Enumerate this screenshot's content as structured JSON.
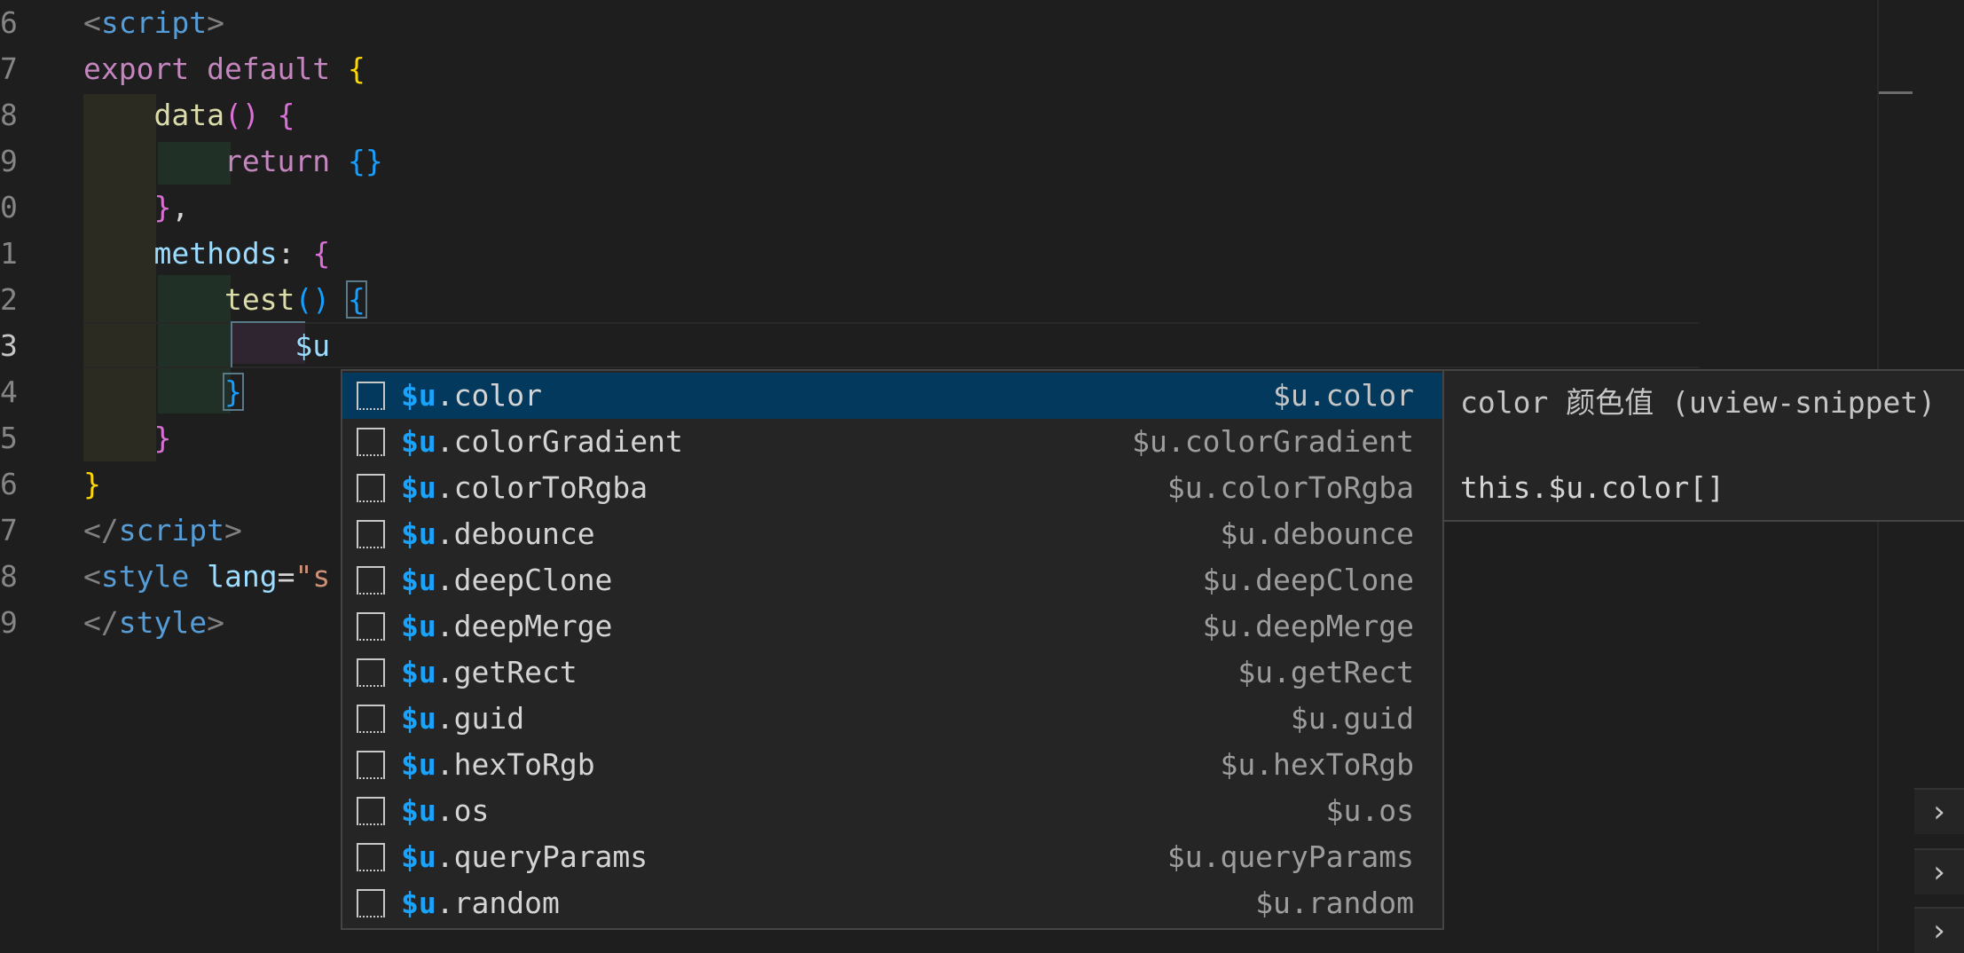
{
  "editor": {
    "line_numbers": [
      "6",
      "7",
      "8",
      "9",
      "0",
      "1",
      "2",
      "3",
      "4",
      "5",
      "6",
      "7",
      "8",
      "9"
    ],
    "active_line_number": "3",
    "lines": [
      [
        {
          "t": "<",
          "c": "c-tag"
        },
        {
          "t": "script",
          "c": "c-tagname"
        },
        {
          "t": ">",
          "c": "c-tag"
        }
      ],
      [
        {
          "t": "export default ",
          "c": "c-kw"
        },
        {
          "t": "{",
          "c": "c-b1"
        }
      ],
      [
        {
          "t": "    ",
          "c": "c-plain"
        },
        {
          "t": "data",
          "c": "c-fn"
        },
        {
          "t": "() ",
          "c": "c-b2"
        },
        {
          "t": "{",
          "c": "c-b2"
        }
      ],
      [
        {
          "t": "        ",
          "c": "c-plain"
        },
        {
          "t": "return ",
          "c": "c-kw"
        },
        {
          "t": "{}",
          "c": "c-b3"
        }
      ],
      [
        {
          "t": "    ",
          "c": "c-plain"
        },
        {
          "t": "}",
          "c": "c-b2"
        },
        {
          "t": ",",
          "c": "c-plain"
        }
      ],
      [
        {
          "t": "    ",
          "c": "c-plain"
        },
        {
          "t": "methods",
          "c": "c-prop"
        },
        {
          "t": ": ",
          "c": "c-plain"
        },
        {
          "t": "{",
          "c": "c-b2"
        }
      ],
      [
        {
          "t": "        ",
          "c": "c-plain"
        },
        {
          "t": "test",
          "c": "c-fn"
        },
        {
          "t": "() ",
          "c": "c-b3"
        },
        {
          "t": "{",
          "c": "c-b3 match-bracket"
        }
      ],
      [
        {
          "t": "            ",
          "c": "c-plain"
        },
        {
          "t": "$u",
          "c": "c-prop"
        }
      ],
      [
        {
          "t": "        ",
          "c": "c-plain"
        },
        {
          "t": "}",
          "c": "c-b3 match-bracket"
        }
      ],
      [
        {
          "t": "    ",
          "c": "c-plain"
        },
        {
          "t": "}",
          "c": "c-b2"
        }
      ],
      [
        {
          "t": "}",
          "c": "c-b1"
        }
      ],
      [
        {
          "t": "</",
          "c": "c-tag"
        },
        {
          "t": "script",
          "c": "c-tagname"
        },
        {
          "t": ">",
          "c": "c-tag"
        }
      ],
      [
        {
          "t": "<",
          "c": "c-tag"
        },
        {
          "t": "style ",
          "c": "c-tagname"
        },
        {
          "t": "lang",
          "c": "c-attr"
        },
        {
          "t": "=",
          "c": "c-plain"
        },
        {
          "t": "\"s",
          "c": "c-str"
        }
      ],
      [
        {
          "t": "</",
          "c": "c-tag"
        },
        {
          "t": "style",
          "c": "c-tagname"
        },
        {
          "t": ">",
          "c": "c-tag"
        }
      ]
    ]
  },
  "suggest": {
    "typed_prefix": "$u",
    "selected_index": 0,
    "items": [
      {
        "label_rest": ".color",
        "detail": "$u.color"
      },
      {
        "label_rest": ".colorGradient",
        "detail": "$u.colorGradient"
      },
      {
        "label_rest": ".colorToRgba",
        "detail": "$u.colorToRgba"
      },
      {
        "label_rest": ".debounce",
        "detail": "$u.debounce"
      },
      {
        "label_rest": ".deepClone",
        "detail": "$u.deepClone"
      },
      {
        "label_rest": ".deepMerge",
        "detail": "$u.deepMerge"
      },
      {
        "label_rest": ".getRect",
        "detail": "$u.getRect"
      },
      {
        "label_rest": ".guid",
        "detail": "$u.guid"
      },
      {
        "label_rest": ".hexToRgb",
        "detail": "$u.hexToRgb"
      },
      {
        "label_rest": ".os",
        "detail": "$u.os"
      },
      {
        "label_rest": ".queryParams",
        "detail": "$u.queryParams"
      },
      {
        "label_rest": ".random",
        "detail": "$u.random"
      }
    ],
    "item_icon": "snippet-icon"
  },
  "details": {
    "title": "color 颜色值 (uview-snippet)",
    "documentation": "this.$u.color[]"
  },
  "side_panel": {
    "chevron_icon": "chevron-right-icon",
    "chevron_glyph": "›"
  }
}
